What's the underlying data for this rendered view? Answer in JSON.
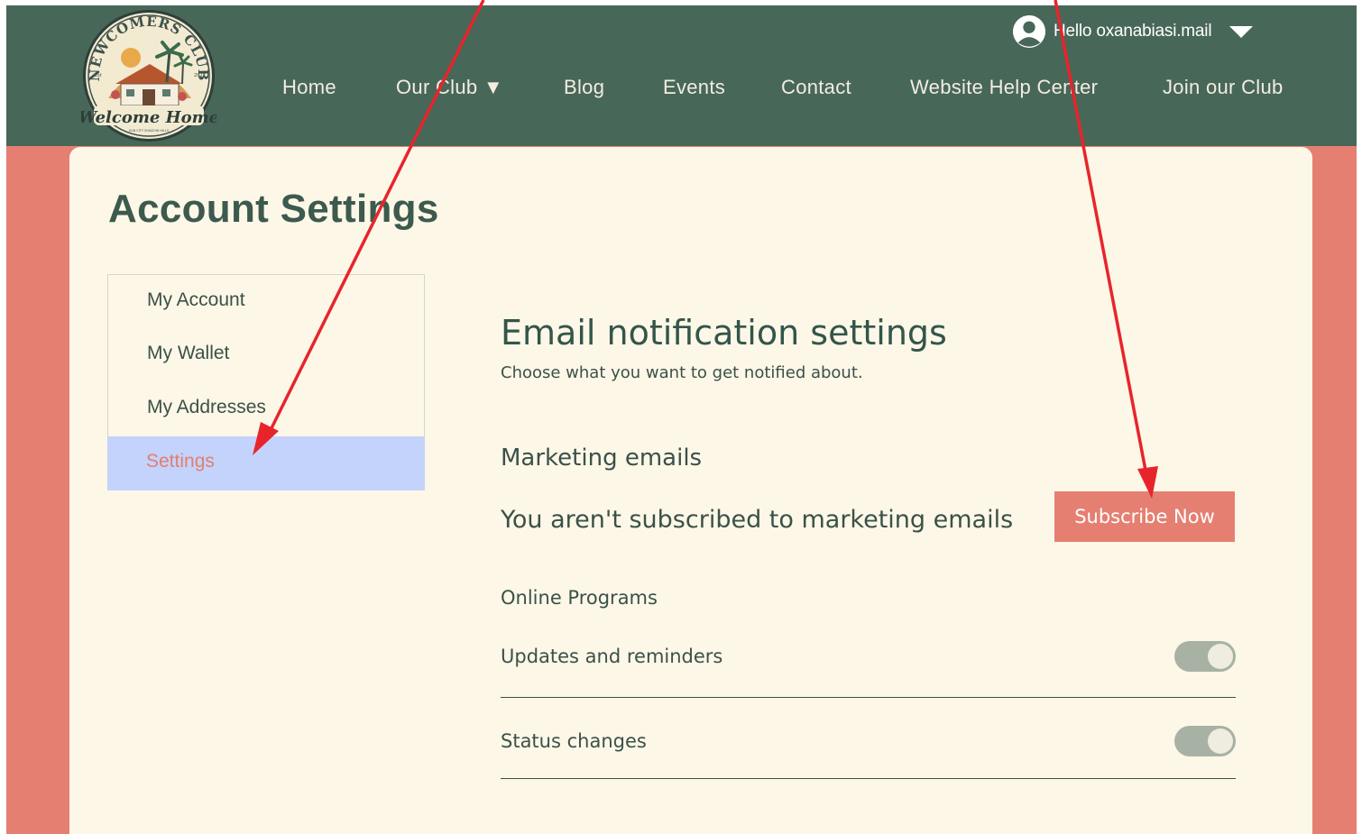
{
  "header": {
    "logo": {
      "arc_text": "NEWCOMERS CLUB",
      "script_text": "Welcome Home",
      "est_left": "Est",
      "est_right": "2023",
      "tiny_text": "SUN CITY SHADOW HILLS"
    },
    "user": {
      "greeting": "Hello oxanabiasi.mail",
      "avatar_icon": "user-circle-icon",
      "caret_icon": "caret-down-icon"
    },
    "nav": [
      {
        "label": "Home"
      },
      {
        "label": "Our Club ▼"
      },
      {
        "label": "Blog"
      },
      {
        "label": "Events"
      },
      {
        "label": "Contact"
      },
      {
        "label": "Website Help Center"
      },
      {
        "label": "Join our Club"
      }
    ]
  },
  "page": {
    "title": "Account Settings",
    "side_menu": [
      {
        "label": "My Account"
      },
      {
        "label": "My Wallet"
      },
      {
        "label": "My Addresses"
      },
      {
        "label": "Settings",
        "active": true
      }
    ]
  },
  "settings": {
    "title": "Email notification settings",
    "subtitle": "Choose what you want to get notified about.",
    "marketing": {
      "title": "Marketing emails",
      "status": "You aren't subscribed to marketing emails",
      "button": "Subscribe Now"
    },
    "online_programs": {
      "title": "Online Programs",
      "items": [
        {
          "label": "Updates and reminders",
          "enabled": true
        },
        {
          "label": "Status changes",
          "enabled": true
        }
      ]
    }
  },
  "colors": {
    "header_bg": "#476759",
    "page_bg": "#e57f72",
    "card_bg": "#fdf7e8",
    "accent": "#e57f72",
    "active_menu_bg": "#c4d3fb",
    "text": "#3b5148",
    "annotation_arrow": "#e8242b"
  }
}
